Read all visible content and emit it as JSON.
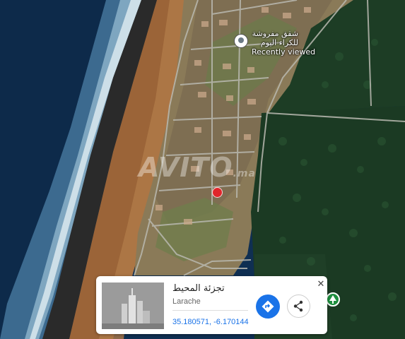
{
  "map": {
    "saved_place": {
      "title": "شقق مفروشة للكراء اليوم",
      "status": "Recently viewed",
      "icon": "location-pin-icon"
    },
    "watermark": {
      "text": "AVITO",
      "suffix": ".ma"
    },
    "selected_marker": {
      "icon": "red-location-marker-icon",
      "color": "#e0262b"
    },
    "park_marker": {
      "icon": "tree-icon",
      "color": "#1e8e3e"
    }
  },
  "place_card": {
    "name": "تجزئة المحيط",
    "city": "Larache",
    "coordinates": "35.180571, -6.170144",
    "close_icon": "close-icon",
    "directions_icon": "directions-icon",
    "share_icon": "share-icon",
    "accent": "#1a73e8"
  }
}
